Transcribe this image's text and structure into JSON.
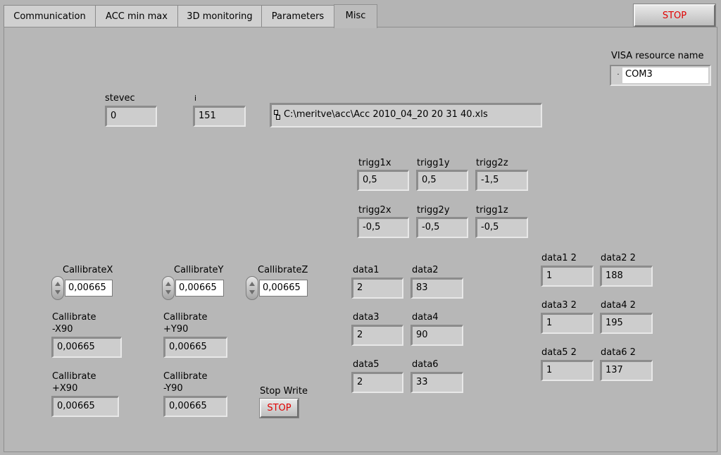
{
  "tabs": [
    {
      "label": "Communication"
    },
    {
      "label": "ACC min max"
    },
    {
      "label": "3D monitoring"
    },
    {
      "label": "Parameters"
    },
    {
      "label": "Misc"
    }
  ],
  "active_tab": "Misc",
  "stop_button": {
    "label": "STOP"
  },
  "visa": {
    "label": "VISA resource name",
    "value": "COM3"
  },
  "stevec": {
    "label": "stevec",
    "value": "0"
  },
  "i": {
    "label": "i",
    "value": "151"
  },
  "file_path": {
    "value": "C:\\meritve\\acc\\Acc 2010_04_20 20 31 40.xls"
  },
  "triggers": {
    "trigg1x": {
      "label": "trigg1x",
      "value": "0,5"
    },
    "trigg1y": {
      "label": "trigg1y",
      "value": "0,5"
    },
    "trigg2z": {
      "label": "trigg2z",
      "value": "-1,5"
    },
    "trigg2x": {
      "label": "trigg2x",
      "value": "-0,5"
    },
    "trigg2y": {
      "label": "trigg2y",
      "value": "-0,5"
    },
    "trigg1z": {
      "label": "trigg1z",
      "value": "-0,5"
    }
  },
  "calibrate": {
    "x": {
      "label": "CallibrateX",
      "value": "0,00665"
    },
    "y": {
      "label": "CallibrateY",
      "value": "0,00665"
    },
    "z": {
      "label": "CallibrateZ",
      "value": "0,00665"
    },
    "minus_x90": {
      "label_line1": "Callibrate",
      "label_line2": "-X90",
      "value": "0,00665"
    },
    "plus_y90": {
      "label_line1": "Callibrate",
      "label_line2": "+Y90",
      "value": "0,00665"
    },
    "plus_x90": {
      "label_line1": "Callibrate",
      "label_line2": "+X90",
      "value": "0,00665"
    },
    "minus_y90": {
      "label_line1": "Callibrate",
      "label_line2": "-Y90",
      "value": "0,00665"
    }
  },
  "data": {
    "data1": {
      "label": "data1",
      "value": "2"
    },
    "data2": {
      "label": "data2",
      "value": "83"
    },
    "data3": {
      "label": "data3",
      "value": "2"
    },
    "data4": {
      "label": "data4",
      "value": "90"
    },
    "data5": {
      "label": "data5",
      "value": "2"
    },
    "data6": {
      "label": "data6",
      "value": "33"
    }
  },
  "data2set": {
    "data1_2": {
      "label": "data1 2",
      "value": "1"
    },
    "data2_2": {
      "label": "data2 2",
      "value": "188"
    },
    "data3_2": {
      "label": "data3 2",
      "value": "1"
    },
    "data4_2": {
      "label": "data4 2",
      "value": "195"
    },
    "data5_2": {
      "label": "data5 2",
      "value": "1"
    },
    "data6_2": {
      "label": "data6 2",
      "value": "137"
    }
  },
  "stop_write": {
    "label": "Stop Write",
    "button_label": "STOP"
  }
}
